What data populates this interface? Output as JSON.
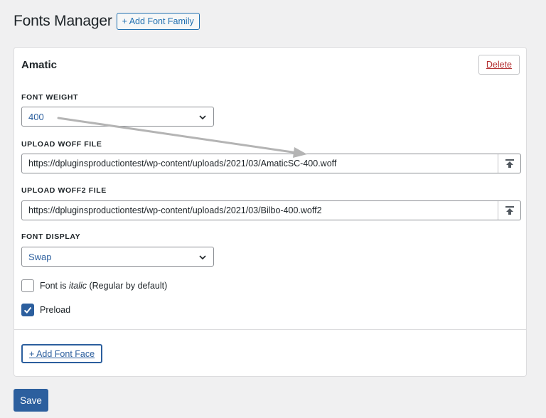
{
  "header": {
    "title": "Fonts Manager",
    "add_font_family_label": "+ Add Font Family"
  },
  "font_family": {
    "name": "Amatic",
    "delete_label": "Delete",
    "font_weight": {
      "label": "FONT WEIGHT",
      "value": "400"
    },
    "woff": {
      "label": "UPLOAD WOFF FILE",
      "value": "https://dpluginsproductiontest/wp-content/uploads/2021/03/AmaticSC-400.woff",
      "upload_icon": "upload-icon"
    },
    "woff2": {
      "label": "UPLOAD WOFF2 FILE",
      "value": "https://dpluginsproductiontest/wp-content/uploads/2021/03/Bilbo-400.woff2",
      "upload_icon": "upload-icon"
    },
    "font_display": {
      "label": "FONT DISPLAY",
      "value": "Swap"
    },
    "italic": {
      "label_prefix": "Font is ",
      "label_italic": "italic",
      "label_suffix": " (Regular by default)",
      "checked": false
    },
    "preload": {
      "label": "Preload",
      "checked": true
    },
    "add_font_face_label": "+ Add Font Face"
  },
  "save_label": "Save",
  "colors": {
    "accent": "#2c5f9e",
    "link": "#2271b1",
    "danger": "#b32d2e",
    "background": "#f0f0f1",
    "annotation_arrow": "#b4b4b4"
  }
}
